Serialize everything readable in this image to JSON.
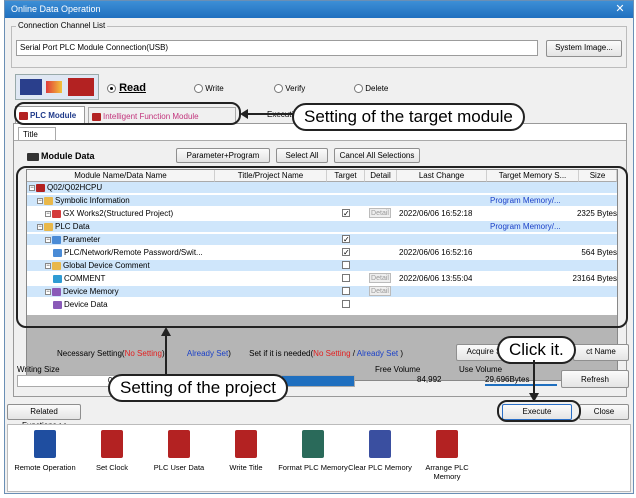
{
  "window": {
    "title": "Online Data Operation",
    "close_glyph": "✕"
  },
  "connection": {
    "group_label": "Connection Channel List",
    "value": "Serial Port  PLC Module Connection(USB)",
    "system_image_button": "System Image..."
  },
  "operations": [
    {
      "label": "Read",
      "selected": true
    },
    {
      "label": "Write",
      "selected": false
    },
    {
      "label": "Verify",
      "selected": false
    },
    {
      "label": "Delete",
      "selected": false
    }
  ],
  "tabs": [
    {
      "label": "PLC Module",
      "active": true
    },
    {
      "label": "Intelligent Function Module",
      "active": false
    }
  ],
  "hidden_tab_fragment": "Executi",
  "title_tab": "Title",
  "module_data": {
    "label": "Module Data",
    "buttons": [
      "Parameter+Program",
      "Select All",
      "Cancel All Selections"
    ]
  },
  "table": {
    "columns": [
      "Module Name/Data Name",
      "Title/Project Name",
      "Target",
      "Detail",
      "Last Change",
      "Target Memory S...",
      "Size"
    ],
    "rows": [
      {
        "name": "Q02/Q02HCPU",
        "title": "",
        "target": null,
        "detail": "",
        "last_change": "",
        "memory": "",
        "size": "",
        "level": 0,
        "blue": true,
        "icon": "cpu"
      },
      {
        "name": "Symbolic Information",
        "title": "",
        "target": null,
        "detail": "",
        "last_change": "",
        "memory": "Program Memory/...",
        "size": "",
        "level": 1,
        "blue": true,
        "icon": "folder"
      },
      {
        "name": "GX Works2(Structured Project)",
        "title": "",
        "target": true,
        "detail": "Detail",
        "last_change": "2022/06/06 16:52:18",
        "memory": "",
        "size": "2325 Bytes",
        "level": 2,
        "blue": false,
        "icon": "project"
      },
      {
        "name": "PLC Data",
        "title": "",
        "target": null,
        "detail": "",
        "last_change": "",
        "memory": "Program Memory/...",
        "size": "",
        "level": 1,
        "blue": true,
        "icon": "folder"
      },
      {
        "name": "Parameter",
        "title": "",
        "target": true,
        "detail": "",
        "last_change": "",
        "memory": "",
        "size": "",
        "level": 2,
        "blue": true,
        "icon": "param"
      },
      {
        "name": "PLC/Network/Remote Password/Swit...",
        "title": "",
        "target": true,
        "detail": "",
        "last_change": "2022/06/06 16:52:16",
        "memory": "",
        "size": "564 Bytes",
        "level": 3,
        "blue": false,
        "icon": "param"
      },
      {
        "name": "Global Device Comment",
        "title": "",
        "target": false,
        "detail": "",
        "last_change": "",
        "memory": "",
        "size": "",
        "level": 2,
        "blue": true,
        "icon": "folder"
      },
      {
        "name": "COMMENT",
        "title": "",
        "target": false,
        "detail": "Detail",
        "last_change": "2022/06/06 13:55:04",
        "memory": "",
        "size": "23164 Bytes",
        "level": 3,
        "blue": false,
        "icon": "comment"
      },
      {
        "name": "Device Memory",
        "title": "",
        "target": false,
        "detail": "Detail",
        "last_change": "",
        "memory": "",
        "size": "",
        "level": 2,
        "blue": true,
        "icon": "device"
      },
      {
        "name": "Device Data",
        "title": "",
        "target": false,
        "detail": "",
        "last_change": "",
        "memory": "",
        "size": "",
        "level": 3,
        "blue": false,
        "icon": "device"
      }
    ]
  },
  "settings": {
    "necessary": "Necessary Setting(",
    "no_setting": "No Setting",
    "close_paren": ")",
    "already_set": "Already Set",
    "needed": "Set if it is needed(",
    "no_setting2": "No Setting",
    "slash": "/",
    "already_set2": "Already Set",
    "close_paren2": ")",
    "acquire_button": "Acquire S",
    "name_button": "ct Name"
  },
  "sizes": {
    "writing_size_label": "Writing Size",
    "writing_bytes": "0B",
    "free_volume_label": "Free Volume",
    "free_volume": "84,992",
    "use_volume_label": "Use Volume",
    "use_volume": "29,696Bytes",
    "refresh_button": "Refresh"
  },
  "footer": {
    "related_button": "Related Functions<<",
    "execute_button": "Execute",
    "close_button": "Close"
  },
  "tools": [
    {
      "label": "Remote Operation",
      "icon": "remote-operation-icon"
    },
    {
      "label": "Set Clock",
      "icon": "set-clock-icon"
    },
    {
      "label": "PLC User Data",
      "icon": "plc-user-data-icon"
    },
    {
      "label": "Write Title",
      "icon": "write-title-icon"
    },
    {
      "label": "Format PLC Memory",
      "icon": "format-memory-icon"
    },
    {
      "label": "Clear PLC Memory",
      "icon": "clear-memory-icon"
    },
    {
      "label": "Arrange PLC Memory",
      "icon": "arrange-memory-icon"
    }
  ],
  "callouts": {
    "target_module": "Setting of the target module",
    "project": "Setting of the project",
    "click": "Click it."
  },
  "colors": {
    "row_blue": "#cfe6fb",
    "memory_link": "#1a40c8",
    "no_setting": "#e21e1e",
    "titlebar": "#1f6fbf"
  }
}
